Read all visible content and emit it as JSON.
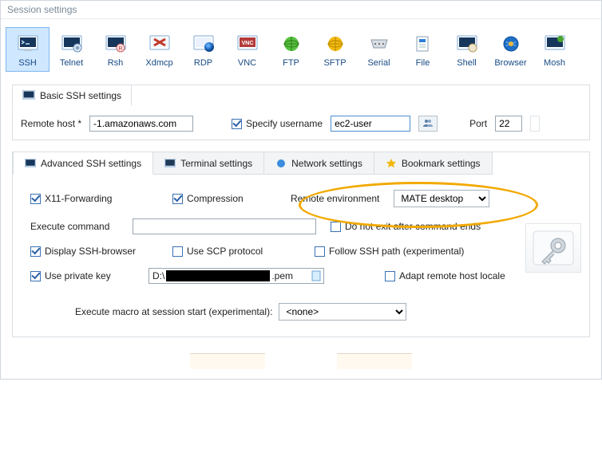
{
  "window_title": "Session settings",
  "protocols": [
    {
      "key": "ssh",
      "label": "SSH"
    },
    {
      "key": "telnet",
      "label": "Telnet"
    },
    {
      "key": "rsh",
      "label": "Rsh"
    },
    {
      "key": "xdmcp",
      "label": "Xdmcp"
    },
    {
      "key": "rdp",
      "label": "RDP"
    },
    {
      "key": "vnc",
      "label": "VNC"
    },
    {
      "key": "ftp",
      "label": "FTP"
    },
    {
      "key": "sftp",
      "label": "SFTP"
    },
    {
      "key": "serial",
      "label": "Serial"
    },
    {
      "key": "file",
      "label": "File"
    },
    {
      "key": "shell",
      "label": "Shell"
    },
    {
      "key": "browser",
      "label": "Browser"
    },
    {
      "key": "mosh",
      "label": "Mosh"
    }
  ],
  "selected_protocol": "ssh",
  "basic": {
    "title": "Basic SSH settings",
    "remote_host_label": "Remote host *",
    "remote_host_value": "-1.amazonaws.com",
    "specify_username_label": "Specify username",
    "specify_username_checked": true,
    "username_value": "ec2-user",
    "port_label": "Port",
    "port_value": "22"
  },
  "adv_tabs": {
    "advanced": "Advanced SSH settings",
    "terminal": "Terminal settings",
    "network": "Network settings",
    "bookmark": "Bookmark settings"
  },
  "adv": {
    "x11_label": "X11-Forwarding",
    "x11_checked": true,
    "compression_label": "Compression",
    "compression_checked": true,
    "remote_env_label": "Remote environment",
    "remote_env_value": "MATE desktop",
    "exec_cmd_label": "Execute command",
    "exec_cmd_value": "",
    "no_exit_label": "Do not exit after command ends",
    "no_exit_checked": false,
    "display_browser_label": "Display SSH-browser",
    "display_browser_checked": true,
    "use_scp_label": "Use SCP protocol",
    "use_scp_checked": false,
    "follow_path_label": "Follow SSH path (experimental)",
    "follow_path_checked": false,
    "use_pkey_label": "Use private key",
    "use_pkey_checked": true,
    "pkey_prefix": "D:\\",
    "pkey_suffix": ".pem",
    "adapt_locale_label": "Adapt remote host locale",
    "adapt_locale_checked": false,
    "macro_label": "Execute macro at session start (experimental):",
    "macro_value": "<none>"
  },
  "colors": {
    "highlight": "#f2a900",
    "sel_bg": "#cfe7ff"
  }
}
